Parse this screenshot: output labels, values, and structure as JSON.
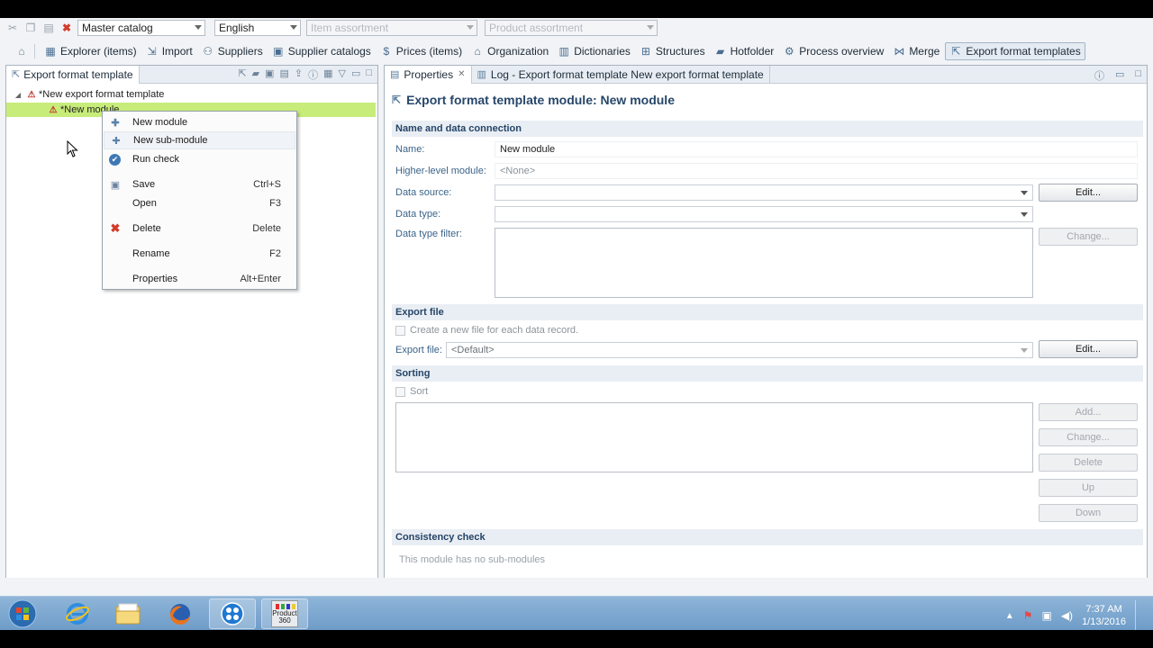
{
  "toolbar1": {
    "catalog": "Master catalog",
    "language": "English",
    "item_assortment": "Item assortment",
    "product_assortment": "Product assortment"
  },
  "toolbar2": {
    "items": [
      {
        "label": "Explorer (items)",
        "icon": "explorer-icon"
      },
      {
        "label": "Import",
        "icon": "import-icon"
      },
      {
        "label": "Suppliers",
        "icon": "suppliers-icon"
      },
      {
        "label": "Supplier catalogs",
        "icon": "supplier-catalogs-icon"
      },
      {
        "label": "Prices (items)",
        "icon": "prices-icon"
      },
      {
        "label": "Organization",
        "icon": "organization-icon"
      },
      {
        "label": "Dictionaries",
        "icon": "dictionaries-icon"
      },
      {
        "label": "Structures",
        "icon": "structures-icon"
      },
      {
        "label": "Hotfolder",
        "icon": "hotfolder-icon"
      },
      {
        "label": "Process overview",
        "icon": "process-overview-icon"
      },
      {
        "label": "Merge",
        "icon": "merge-icon"
      },
      {
        "label": "Export format templates",
        "icon": "export-format-templates-icon"
      }
    ]
  },
  "left_panel": {
    "tab_label": "Export format template",
    "tree": {
      "root": "*New export format template",
      "child": "*New module"
    }
  },
  "context_menu": {
    "items": [
      {
        "label": "New module",
        "shortcut": "",
        "icon": "plus-icon"
      },
      {
        "label": "New sub-module",
        "shortcut": "",
        "icon": "sub-module-icon"
      },
      {
        "label": "Run check",
        "shortcut": "",
        "icon": "check-circle-icon"
      },
      {
        "label": "Save",
        "shortcut": "Ctrl+S",
        "icon": "save-icon"
      },
      {
        "label": "Open",
        "shortcut": "F3",
        "icon": ""
      },
      {
        "label": "Delete",
        "shortcut": "Delete",
        "icon": "delete-x-icon"
      },
      {
        "label": "Rename",
        "shortcut": "F2",
        "icon": ""
      },
      {
        "label": "Properties",
        "shortcut": "Alt+Enter",
        "icon": ""
      }
    ]
  },
  "right_panel": {
    "tabs": [
      {
        "label": "Properties"
      },
      {
        "label": "Log - Export format template New export format template"
      }
    ],
    "title": "Export format template module: New module",
    "sections": {
      "name_data": "Name and data connection",
      "export_file": "Export file",
      "sorting": "Sorting",
      "consistency": "Consistency check"
    },
    "fields": {
      "name_label": "Name:",
      "name_value": "New module",
      "higher_label": "Higher-level module:",
      "higher_value": "<None>",
      "datasource_label": "Data source:",
      "datatype_label": "Data type:",
      "datatype_filter_label": "Data type filter:",
      "create_file_label": "Create a new file for each data record.",
      "export_file_label": "Export file:",
      "export_file_value": "<Default>",
      "sort_label": "Sort",
      "consistency_text": "This module has no sub-modules"
    },
    "buttons": {
      "edit": "Edit...",
      "change": "Change...",
      "edit2": "Edit...",
      "add": "Add...",
      "change2": "Change...",
      "delete": "Delete",
      "up": "Up",
      "down": "Down"
    }
  },
  "taskbar": {
    "time": "7:37 AM",
    "date": "1/13/2016",
    "product_label_1": "Product",
    "product_label_2": "360"
  }
}
